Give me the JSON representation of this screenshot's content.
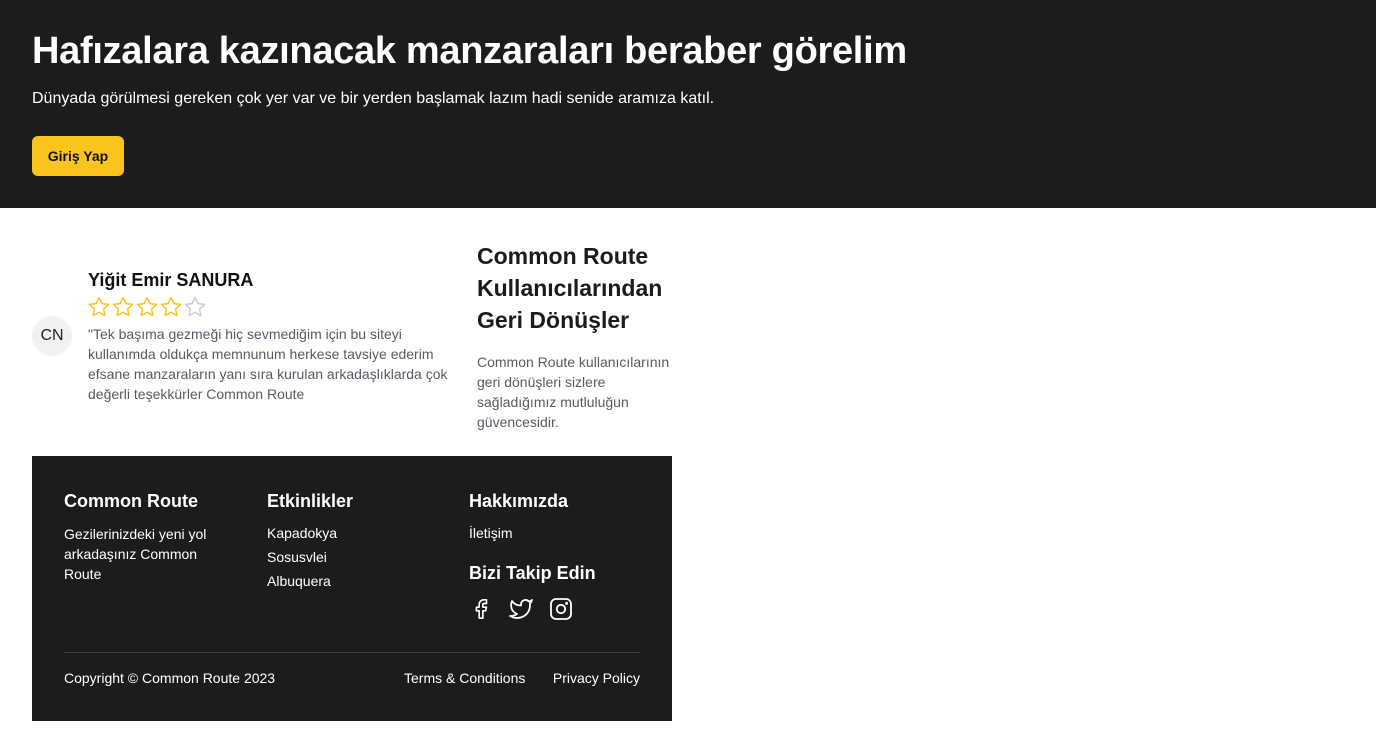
{
  "hero": {
    "title": "Hafızalara kazınacak manzaraları beraber görelim",
    "subtitle": "Dünyada görülmesi gereken çok yer var ve bir yerden başlamak lazım hadi senide aramıza katıl.",
    "login_button": "Giriş Yap",
    "background_color": "#1c1c1c",
    "button_color": "#fbc41d"
  },
  "testimonial": {
    "avatar_initials": "CN",
    "name": "Yiğit Emir SANURA",
    "rating": 4,
    "rating_max": 5,
    "star_color": "#fbc41d",
    "quote": "\"Tek başıma gezmeği hiç sevmediğim için bu siteyi kullanımda oldukça memnunum herkese tavsiye ederim efsane manzaraların yanı sıra kurulan arkadaşlıklarda çok değerli teşekkürler Common Route"
  },
  "feedback": {
    "title": "Common Route Kullanıcılarından Geri Dönüşler",
    "description": "Common Route kullanıcılarının geri dönüşleri sizlere sağladığımız mutluluğun güvencesidir."
  },
  "footer": {
    "brand": {
      "title": "Common Route",
      "tagline": "Gezilerinizdeki yeni yol arkadaşınız Common Route"
    },
    "events": {
      "title": "Etkinlikler",
      "items": [
        "Kapadokya",
        "Sosusvlei",
        "Albuquera"
      ]
    },
    "about": {
      "title": "Hakkımızda",
      "contact": "İletişim"
    },
    "follow": {
      "title": "Bizi Takip Edin",
      "icons": [
        "facebook-icon",
        "twitter-icon",
        "instagram-icon"
      ]
    },
    "copyright": "Copyright © Common Route 2023",
    "links": {
      "terms": "Terms & Conditions",
      "privacy": "Privacy Policy"
    }
  }
}
